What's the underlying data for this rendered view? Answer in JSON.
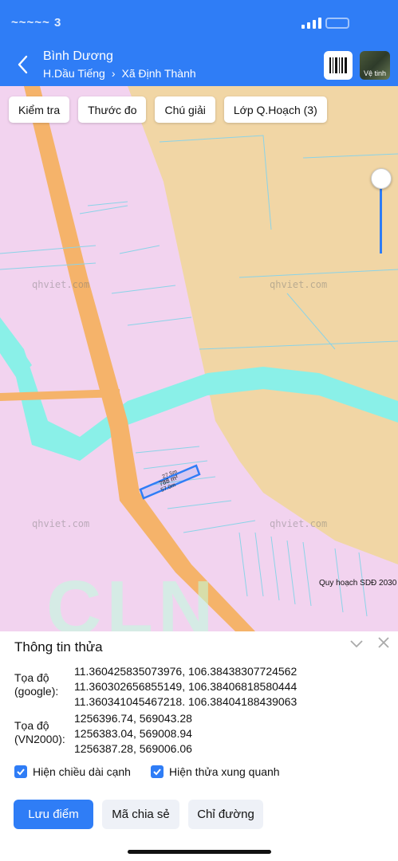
{
  "status_bar": {
    "carrier_text": "~~~~~ 3",
    "signal_icon": "signal-icon",
    "battery_icon": "battery-icon"
  },
  "header": {
    "title": "Bình Dương",
    "crumb_1": "H.Dầu Tiếng",
    "crumb_sep": "›",
    "crumb_2": "Xã Định Thành",
    "back_icon": "chevron-left-icon",
    "barcode_icon": "barcode-icon",
    "satellite_label": "Vệ tinh",
    "accent_color": "#2f7df6"
  },
  "toolbar": {
    "check_label": "Kiểm tra",
    "measure_label": "Thước đo",
    "legend_label": "Chú giải",
    "layers_label": "Lớp Q.Hoạch (3)"
  },
  "map": {
    "watermark": "qhviet.com",
    "plan_label": "Quy hoạch SDĐ 2030",
    "big_letters": "CLN",
    "parcel_length": "27.5m",
    "parcel_area": "788 m²",
    "parcel_width": "57.0m",
    "colors": {
      "residential": "#f1d6a5",
      "zone": "#f2d3ef",
      "river": "#8af0e8",
      "road": "#f5b36a"
    }
  },
  "panel": {
    "title": "Thông tin thửa",
    "collapse_icon": "chevron-down-icon",
    "close_icon": "close-icon",
    "google_label_1": "Tọa độ",
    "google_label_2": "(google):",
    "google_coords": [
      "11.360425835073976, 106.38438307724562",
      "11.360302656855149, 106.38406818580444",
      "11.360341045467218, 106.38404188439063"
    ],
    "vn_label_1": "Tọa độ",
    "vn_label_2": "(VN2000):",
    "vn_coords": [
      "1256396.74, 569043.28",
      "1256383.04, 569008.94",
      "1256387.28, 569006.06"
    ],
    "check_1": "Hiện chiều dài cạnh",
    "check_2": "Hiện thửa xung quanh",
    "save_button": "Lưu điểm",
    "share_button": "Mã chia sẻ",
    "route_button": "Chỉ đường"
  }
}
